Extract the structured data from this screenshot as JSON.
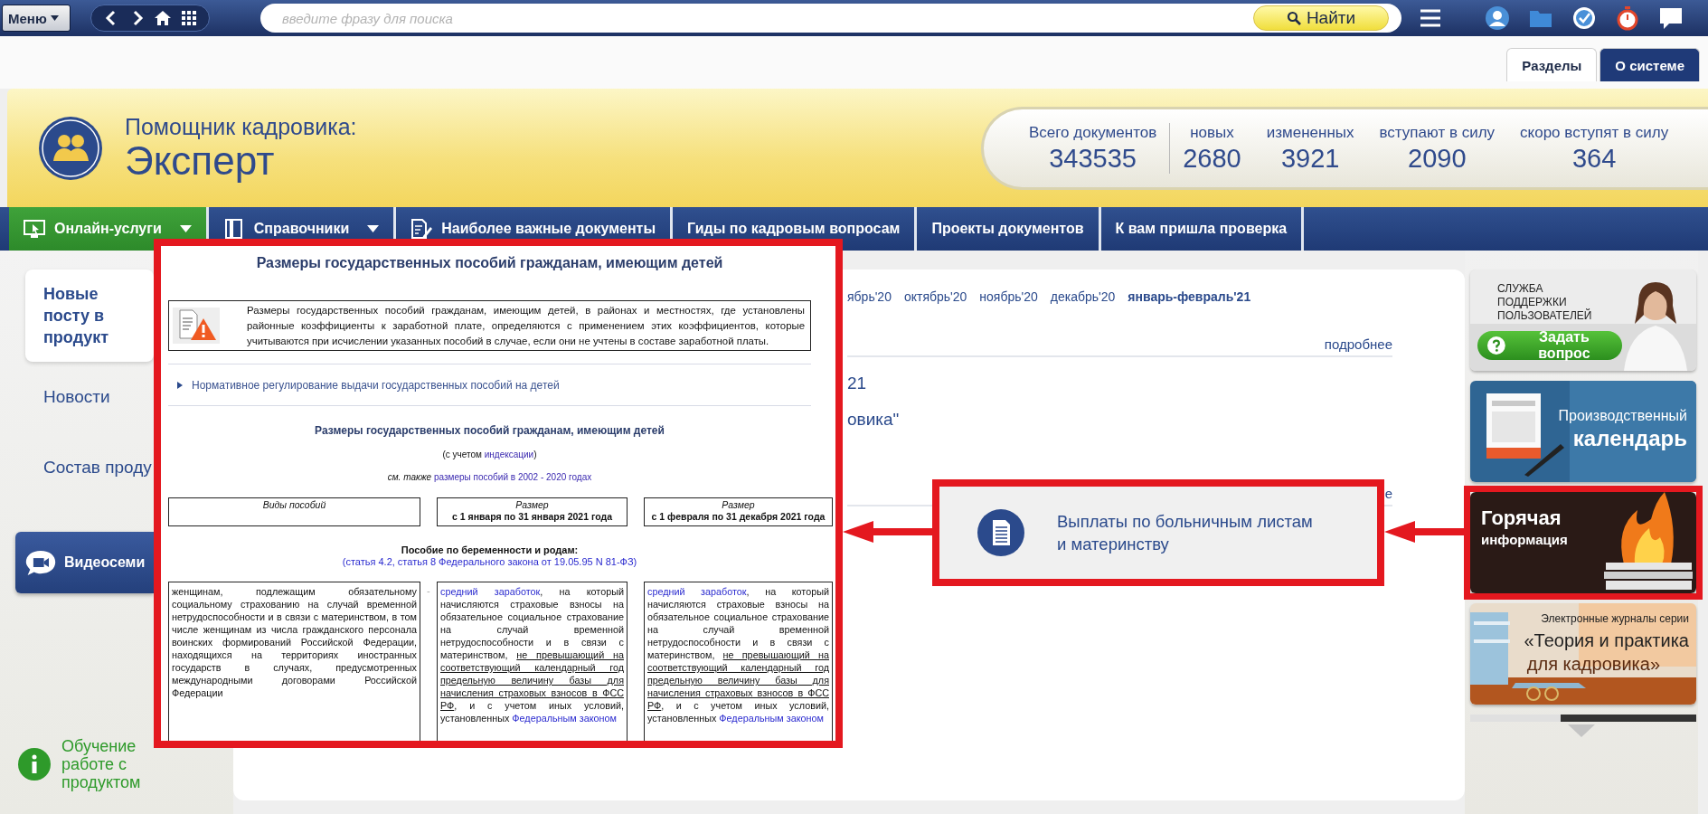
{
  "topbar": {
    "menu_button": "Меню",
    "search": {
      "placeholder": "введите фразу для поиска"
    },
    "find_button": "Найти"
  },
  "tabs": [
    {
      "label": "Разделы",
      "selected": true
    },
    {
      "label": "О системе",
      "selected": false
    }
  ],
  "header": {
    "subtitle": "Помощник кадровика:",
    "title": "Эксперт",
    "stats": [
      {
        "label": "Всего документов",
        "value": "343535"
      },
      {
        "label": "новых",
        "value": "2680"
      },
      {
        "label": "измененных",
        "value": "3921"
      },
      {
        "label": "вступают в силу",
        "value": "2090"
      },
      {
        "label": "скоро вступят в силу",
        "value": "364"
      }
    ]
  },
  "nav": [
    {
      "label": "Онлайн-услуги",
      "dropdown": true,
      "selected": true
    },
    {
      "label": "Справочники",
      "dropdown": true,
      "selected": false
    },
    {
      "label": "Наиболее важные документы",
      "dropdown": false,
      "selected": false
    },
    {
      "label": "Гиды по кадровым вопросам",
      "dropdown": false,
      "selected": false
    },
    {
      "label": "Проекты документов",
      "dropdown": false,
      "selected": false
    },
    {
      "label": "К вам пришла проверка",
      "dropdown": false,
      "selected": false
    }
  ],
  "sidebar": {
    "items": [
      {
        "label": "Новые посту в продукт",
        "selected": true
      },
      {
        "label": "Новости",
        "selected": false
      },
      {
        "label": "Состав проду",
        "selected": false
      }
    ],
    "video_button": "Видеосеми",
    "training_link": "Обучение работе с продуктом"
  },
  "main": {
    "months": [
      {
        "label": "ябрь'20",
        "selected": false
      },
      {
        "label": "октябрь'20",
        "selected": false
      },
      {
        "label": "ноябрь'20",
        "selected": false
      },
      {
        "label": "декабрь'20",
        "selected": false
      },
      {
        "label": "январь-февраль'21",
        "selected": true
      }
    ],
    "more_link": "подробнее",
    "lines": [
      "21",
      "овика\""
    ],
    "more_link_2": "е"
  },
  "document": {
    "title": "Размеры государственных пособий гражданам, имеющим детей",
    "notice": "Размеры государственных пособий гражданам, имеющим детей, в районах и местностях, где установлены районные коэффициенты к заработной плате, определяются с применением этих коэффициентов, которые учитываются при исчислении указанных пособий в случае, если они не учтены в составе заработной платы.",
    "section": {
      "label": "Нормативное регулирование выдачи государственных пособий на детей",
      "expanded": false
    },
    "heading": "Размеры государственных пособий гражданам, имеющим детей",
    "notes": [
      [
        {
          "kind": "plain",
          "text": "(с учетом "
        },
        {
          "kind": "link",
          "text": "индексации"
        },
        {
          "kind": "plain",
          "text": ")"
        }
      ],
      [
        {
          "kind": "italic",
          "text": "см. также "
        },
        {
          "kind": "link",
          "text": "размеры пособий в 2002 - 2020 годах"
        }
      ]
    ],
    "table_header": [
      {
        "title": "Виды пособий"
      },
      {
        "title": "Размер",
        "period": "с 1 января по 31 января 2021 года"
      },
      {
        "title": "Размер",
        "period": "с 1 февраля по 31 декабря 2021 года"
      }
    ],
    "benefit": {
      "title": "Пособие по беременности и родам:",
      "reference": "(статья 4.2, статья 8 Федерального закона от 19.05.95 N 81-ФЗ)"
    },
    "row": {
      "separator": "-",
      "cells": [
        [
          {
            "kind": "plain",
            "text": "женщинам, подлежащим обязательному социальному страхованию на случай временной нетрудоспособности и в связи с материнством, в том числе женщинам из числа гражданского персонала воинских формирований Российской Федерации, находящихся на территориях иностранных государств в случаях, предусмотренных международными договорами Российской Федерации"
          }
        ],
        [
          {
            "kind": "link",
            "text": "средний заработок"
          },
          {
            "kind": "plain",
            "text": ", на который начисляются страховые взносы на обязательное социальное страхование на случай временной нетрудоспособности и в связи с материнством, "
          },
          {
            "kind": "underline",
            "text": "не превышающий на соответствующий календарный год предельную величину базы для начисления страховых взносов в ФСС РФ"
          },
          {
            "kind": "plain",
            "text": ", и с учетом иных условий, установленных "
          },
          {
            "kind": "link",
            "text": "Федеральным законом"
          }
        ],
        [
          {
            "kind": "link",
            "text": "средний заработок"
          },
          {
            "kind": "plain",
            "text": ", на который начисляются страховые взносы на обязательное социальное страхование на случай временной нетрудоспособности и в связи с материнством, "
          },
          {
            "kind": "underline",
            "text": "не превышающий на соответствующий календарный год предельную величину базы для начисления страховых взносов в ФСС РФ"
          },
          {
            "kind": "plain",
            "text": ", и с учетом иных условий, установленных "
          },
          {
            "kind": "link",
            "text": "Федеральным законом"
          }
        ]
      ]
    }
  },
  "callout": {
    "text": "Выплаты по больничным листам и материнству"
  },
  "banners": [
    {
      "kind": "support",
      "caption": "СЛУЖБА ПОДДЕРЖКИ ПОЛЬЗОВАТЕЛЕЙ",
      "button": "Задать вопрос",
      "highlighted": false
    },
    {
      "kind": "calendar",
      "lines": [
        "Производственный",
        "календарь"
      ],
      "highlighted": false
    },
    {
      "kind": "hot",
      "lines": [
        "Горячая",
        "информация"
      ],
      "highlighted": true
    },
    {
      "kind": "journals",
      "lines": [
        "Электронные журналы серии",
        "«Теория и практика",
        "для кадровика»"
      ],
      "highlighted": false
    }
  ]
}
